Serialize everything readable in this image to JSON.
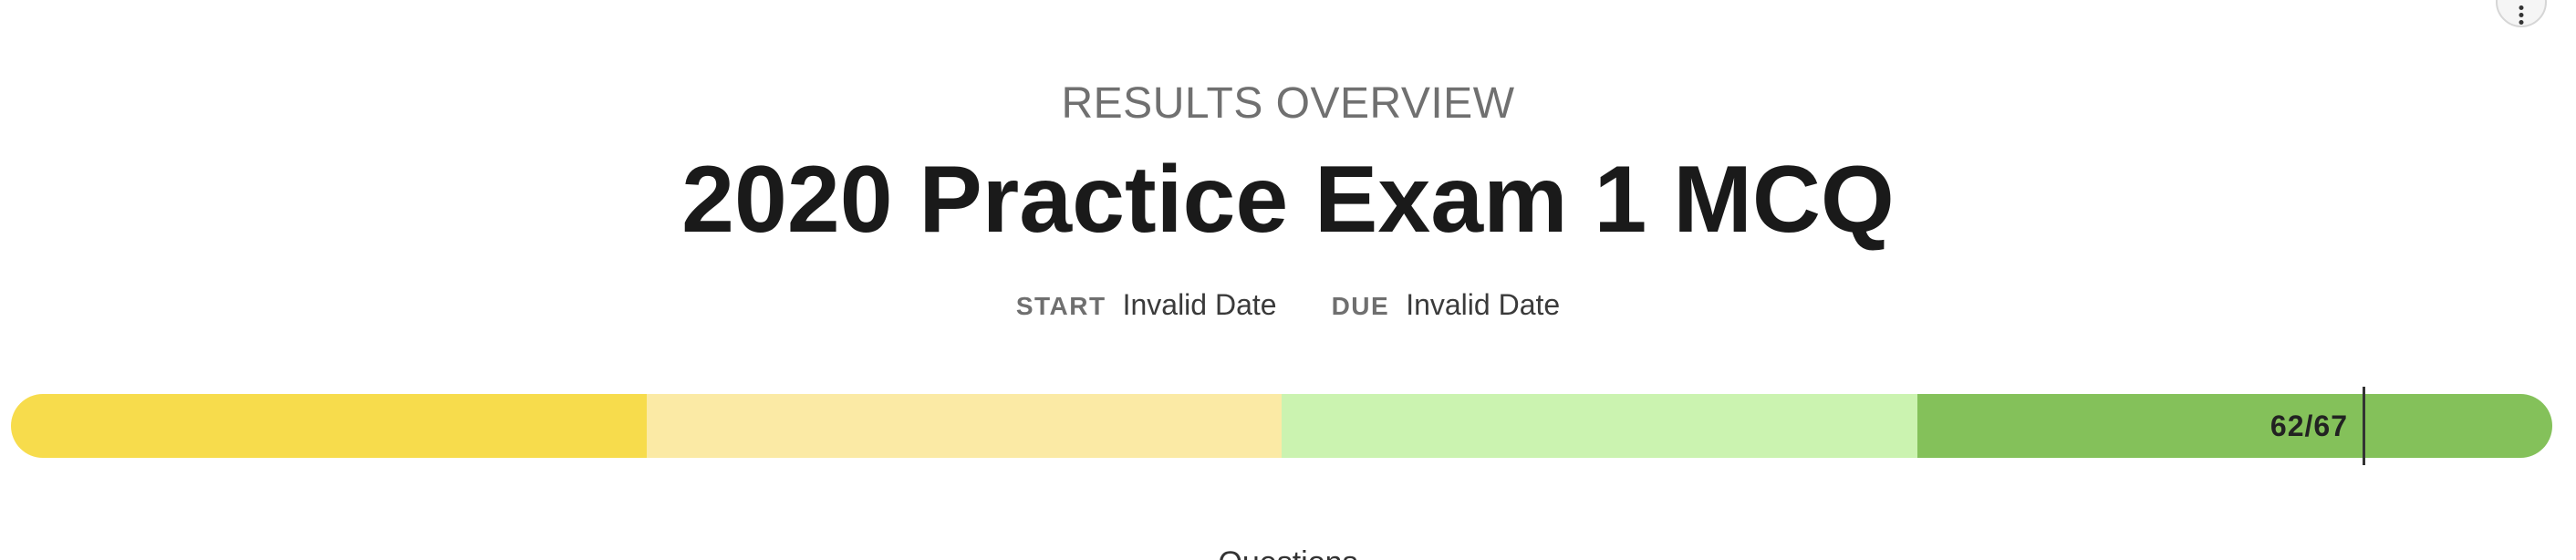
{
  "overview": {
    "overline": "RESULTS OVERVIEW",
    "title": "2020 Practice Exam 1 MCQ"
  },
  "dates": {
    "start_label": "START",
    "start_value": "Invalid Date",
    "due_label": "DUE",
    "due_value": "Invalid Date"
  },
  "score": {
    "label": "62/67",
    "correct": 62,
    "total": 67
  },
  "progress_bands": [
    {
      "name": "band-1",
      "color": "#f7dc4c",
      "fraction": 0.25
    },
    {
      "name": "band-2",
      "color": "#fbeaa5",
      "fraction": 0.25
    },
    {
      "name": "band-3",
      "color": "#cbf3b0",
      "fraction": 0.25
    },
    {
      "name": "band-4",
      "color": "#84c15a",
      "fraction": 0.25
    }
  ],
  "footer": {
    "questions_label": "Questions"
  },
  "menu": {
    "icon": "more-vertical-icon"
  }
}
